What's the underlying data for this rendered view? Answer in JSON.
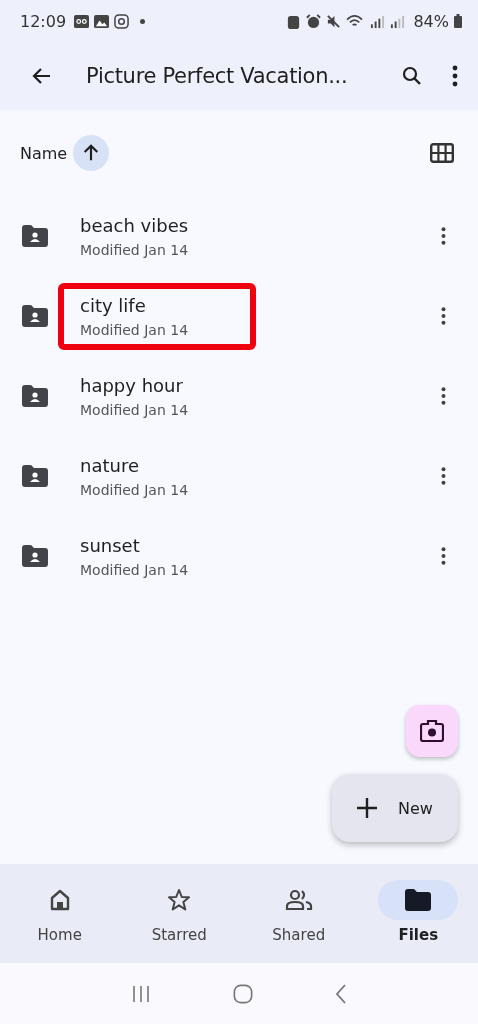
{
  "status_bar": {
    "time": "12:09",
    "battery": "84%"
  },
  "app_bar": {
    "title": "Picture Perfect Vacation..."
  },
  "sort": {
    "label": "Name"
  },
  "files": [
    {
      "name": "beach vibes",
      "modified": "Modified Jan 14",
      "highlighted": false
    },
    {
      "name": "city life",
      "modified": "Modified Jan 14",
      "highlighted": true
    },
    {
      "name": "happy hour",
      "modified": "Modified Jan 14",
      "highlighted": false
    },
    {
      "name": "nature",
      "modified": "Modified Jan 14",
      "highlighted": false
    },
    {
      "name": "sunset",
      "modified": "Modified Jan 14",
      "highlighted": false
    }
  ],
  "new_button": {
    "label": "New"
  },
  "bottom_nav": [
    {
      "label": "Home",
      "kind": "home",
      "selected": false
    },
    {
      "label": "Starred",
      "kind": "star",
      "selected": false
    },
    {
      "label": "Shared",
      "kind": "shared",
      "selected": false
    },
    {
      "label": "Files",
      "kind": "files",
      "selected": true
    }
  ]
}
